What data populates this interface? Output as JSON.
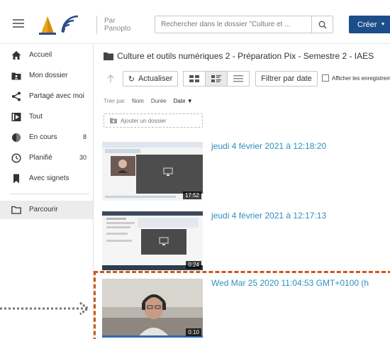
{
  "header": {
    "brand_line1": "Par",
    "brand_line2": "Panopto",
    "search_placeholder": "Rechercher dans le dossier \"Culture et ...",
    "create_label": "Créer"
  },
  "sidebar": {
    "items": [
      {
        "label": "Accueil"
      },
      {
        "label": "Mon dossier"
      },
      {
        "label": "Partagé avec moi"
      },
      {
        "label": "Tout"
      },
      {
        "label": "En cours",
        "count": "8"
      },
      {
        "label": "Planifié",
        "count": "30"
      },
      {
        "label": "Avec signets"
      },
      {
        "label": "Parcourir"
      }
    ]
  },
  "main": {
    "folder_title": "Culture et outils numériques 2 - Préparation Pix - Semestre 2 - IAES",
    "toolbar": {
      "refresh_label": "Actualiser",
      "filter_label": "Filtrer par date",
      "show_label": "Afficher les enregistrements"
    },
    "sort": {
      "label": "Trier par",
      "options": [
        "Nom",
        "Durée",
        "Date"
      ],
      "active": "Date"
    },
    "add_folder_label": "Ajouter un dossier",
    "sessions": [
      {
        "title": "jeudi 4 février 2021 à 12:18:20",
        "duration": "17:52"
      },
      {
        "title": "jeudi 4 février 2021 à 12:17:13",
        "duration": "0:24"
      },
      {
        "title": "Wed Mar 25 2020 11:04:53 GMT+0100 (h",
        "duration": "0:10"
      }
    ]
  },
  "colors": {
    "brand_blue": "#1d4e89",
    "link_blue": "#2d8fbf",
    "highlight_orange": "#c85a1a"
  }
}
